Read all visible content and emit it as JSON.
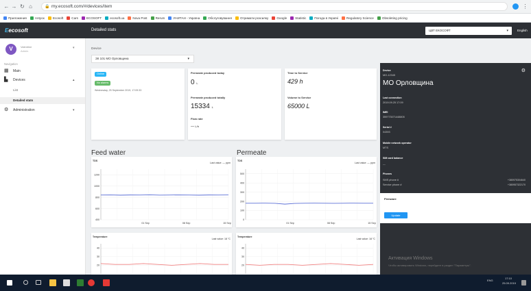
{
  "browser": {
    "url": "my.ecosoft.com/#/devices/item",
    "bookmarks": [
      "Приложения",
      "Antyox",
      "Ecosoft",
      "Cars",
      "ECOSOFT",
      "ecosoft.ua",
      "Nova Post",
      "Rerum",
      "УНИТАН - Україна",
      "Обслуговування",
      "Отримати розсилку",
      "Google",
      "Statistic",
      "Погода в Україні",
      "Regulatory Science",
      "Obsoleting pricing"
    ]
  },
  "app": {
    "logo_prefix": "E",
    "logo_rest": "ecosoft",
    "header_title": "Detailed stats",
    "company": "ЦВТ ЕКОСОФТ",
    "language": "English"
  },
  "sidebar": {
    "avatar_letter": "V",
    "user_name": "Valentine",
    "user_sub": "Admin",
    "section_label": "Navigation",
    "items": [
      {
        "label": "Main",
        "icon": "dashboard-icon"
      },
      {
        "label": "Devices",
        "icon": "devices-icon"
      },
      {
        "label": "Administration",
        "icon": "settings-icon"
      }
    ],
    "sub_items": [
      "List",
      "Detailed stats"
    ]
  },
  "main": {
    "device_label": "Device",
    "device_value": "ЗК 101 МО Орловщина",
    "status": {
      "online": "Online",
      "no_alarms": "No alarms",
      "time": "Wednesday, 25 September 2019, 17:09:33"
    },
    "production": {
      "today_label": "Permeate produced today",
      "today_value": "0",
      "today_unit": "L",
      "totally_label": "Permeate produced totally",
      "totally_value": "15334",
      "totally_unit": "L",
      "flow_label": "Flow rate",
      "flow_value": "—",
      "flow_unit": "L/h"
    },
    "service": {
      "time_label": "Time to Service",
      "time_value": "429 h",
      "volume_label": "Volume to Service",
      "volume_value": "65000 L"
    }
  },
  "info": {
    "device_key": "Device",
    "device_id": "MO-12345",
    "device_name": "МО Орловщина",
    "last_conn_key": "Last connection",
    "last_conn_val": "2019.09.25 17:09",
    "imei_key": "IMEI",
    "imei_val": "359773071448805",
    "serial_key": "Serial #",
    "serial_val": "04393",
    "operator_key": "Mobile network operator",
    "operator_val": "MTS",
    "balance_key": "SIM card balance",
    "balance_val": "—",
    "phones_key": "Phones",
    "sms_key": "SMS phone #",
    "sms_val": "+380975304640",
    "service_key": "Service phone #",
    "service_val": "+380957322170",
    "install_title": "Firmware",
    "install_btn": "Update",
    "watermark1": "Активация Windows",
    "watermark2": "Чтобы активировать Windows, перейдите в раздел \"Параметры\"."
  },
  "charts": {
    "feed_title": "Feed water",
    "permeate_title": "Permeate",
    "tds_label": "TDS",
    "feed_last": "Last value: — ppm",
    "perm_last": "Last value: — ppm",
    "temp_label": "Temperature",
    "feed_temp_last": "Last value: 18 °C",
    "perm_temp_last": "Last value: 18 °C"
  },
  "chart_data": [
    {
      "type": "line",
      "title": "Feed water",
      "ylabel": "TDS",
      "categories": [
        "01 Sep",
        "08 Sep",
        "15 Sep"
      ],
      "ylim": [
        400,
        1300
      ],
      "yticks": [
        400,
        600,
        800,
        1000,
        1200
      ],
      "series": [
        {
          "values": [
            840,
            842,
            838,
            841,
            840,
            843,
            839,
            840,
            842,
            840,
            838,
            841,
            840,
            842
          ]
        }
      ],
      "color": "#5b6fd6"
    },
    {
      "type": "line",
      "title": "Permeate",
      "ylabel": "TDS",
      "categories": [
        "01 Sep",
        "08 Sep",
        "15 Sep"
      ],
      "ylim": [
        0,
        550
      ],
      "yticks": [
        0,
        100,
        200,
        300,
        400,
        500
      ],
      "series": [
        {
          "values": [
            180,
            180,
            181,
            179,
            170,
            178,
            180,
            181,
            180,
            179,
            180,
            181,
            180,
            180
          ]
        }
      ],
      "color": "#5b6fd6"
    },
    {
      "type": "line",
      "title": "Temperature",
      "ylabel": "",
      "ylim": [
        10,
        45
      ],
      "yticks": [
        20,
        30,
        40
      ],
      "series": [
        {
          "values": [
            22,
            21,
            21,
            22,
            21,
            20,
            21,
            22,
            21,
            21
          ]
        }
      ],
      "color": "#f08080"
    },
    {
      "type": "line",
      "title": "Temperature",
      "ylabel": "",
      "ylim": [
        10,
        45
      ],
      "yticks": [
        20,
        30,
        40
      ],
      "series": [
        {
          "values": [
            21,
            20,
            21,
            21,
            20,
            21,
            22,
            21,
            20,
            21
          ]
        }
      ],
      "color": "#f08080"
    }
  ],
  "taskbar": {
    "lang": "ENG",
    "time": "17:10",
    "date": "25.09.2019"
  }
}
